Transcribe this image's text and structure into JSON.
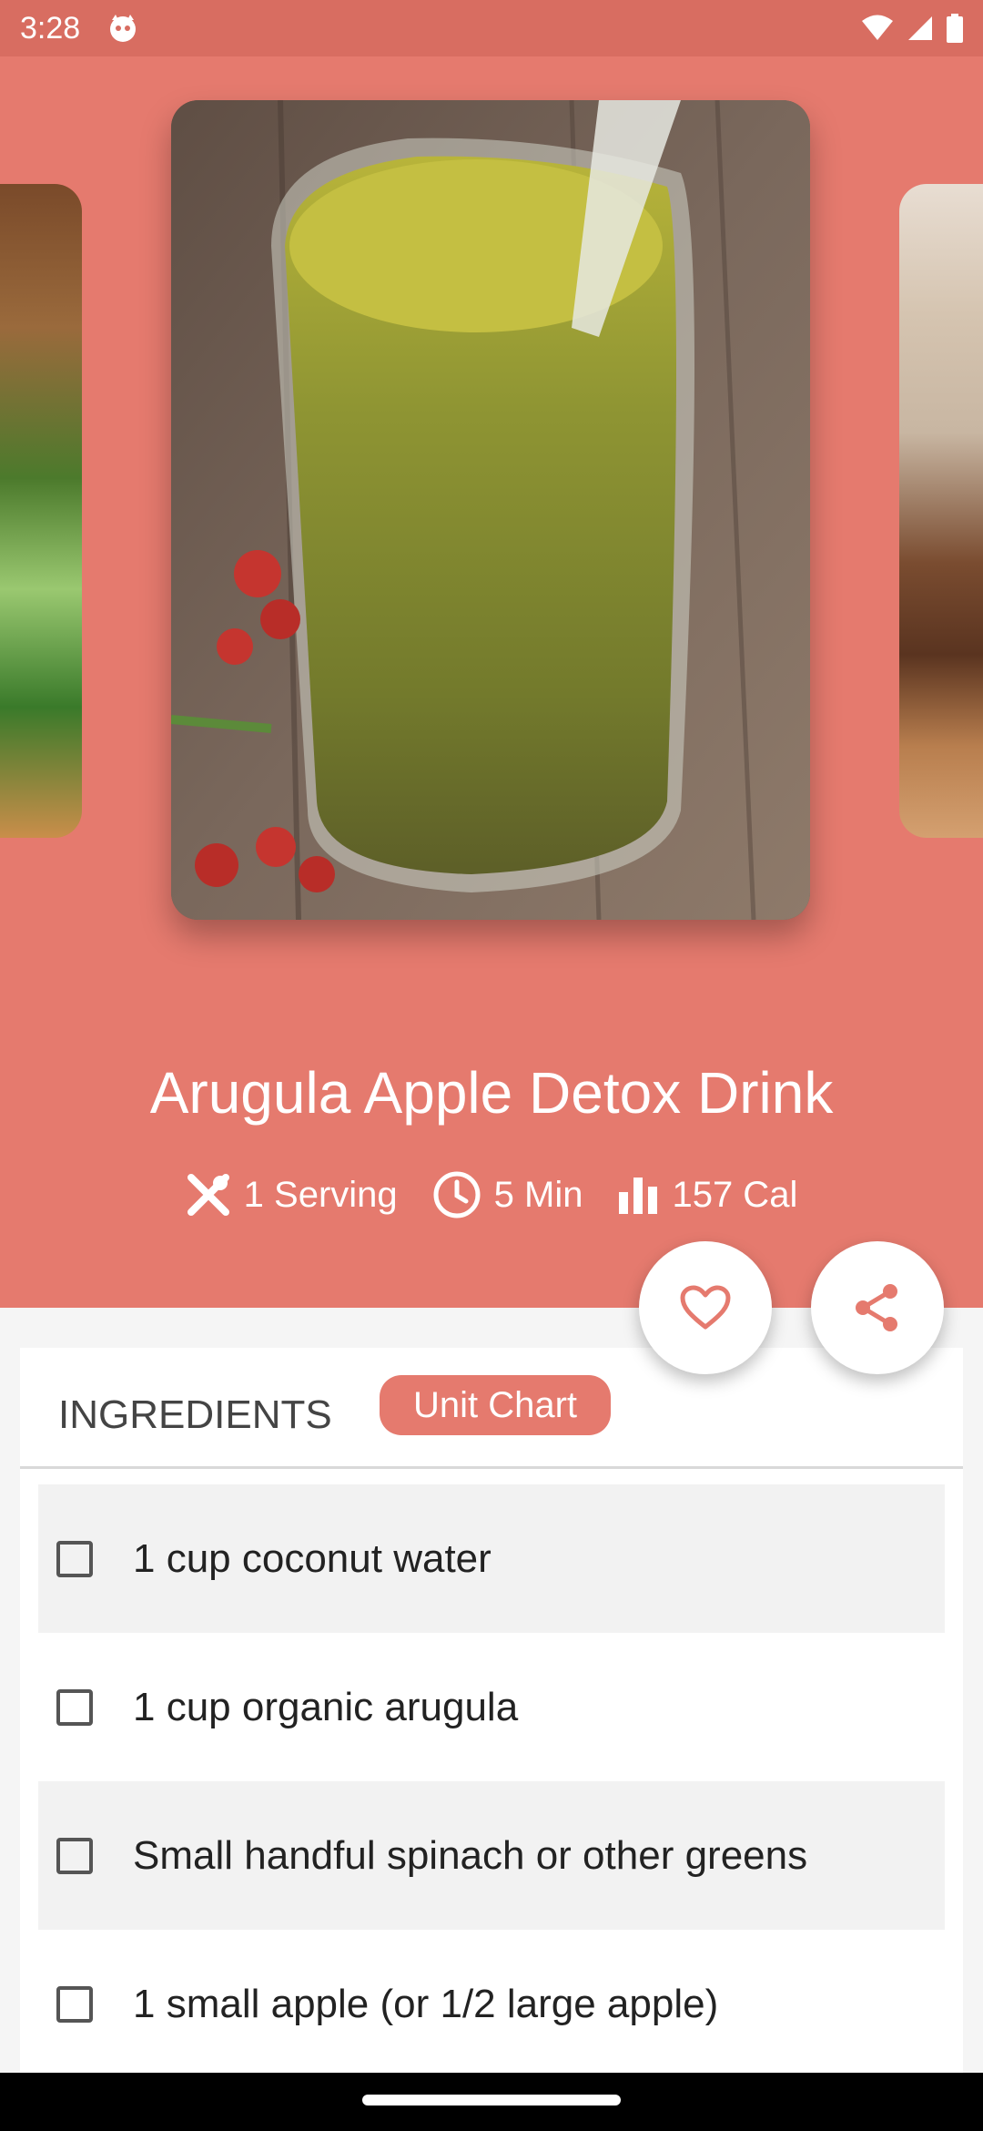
{
  "status_bar": {
    "time": "3:28",
    "icons": [
      "app-notification-icon",
      "wifi-icon",
      "signal-icon",
      "battery-icon"
    ]
  },
  "recipe": {
    "title": "Arugula Apple Detox Drink",
    "meta": {
      "servings": "1 Serving",
      "time": "5 Min",
      "calories": "157 Cal"
    }
  },
  "tabs": {
    "ingredients": "INGREDIENTS",
    "unit_chart": "Unit Chart"
  },
  "ingredients": [
    "1 cup coconut water",
    "1 cup organic arugula",
    "Small handful spinach or other greens",
    "1 small apple (or 1/2 large apple)"
  ],
  "colors": {
    "accent": "#e57a6e",
    "status_bar": "#d86d61",
    "row_shade": "#f2f2f2"
  },
  "icons": {
    "favorite": "heart-outline-icon",
    "share": "share-icon",
    "servings": "fork-knife-icon",
    "time": "clock-icon",
    "calories": "bar-chart-icon"
  }
}
